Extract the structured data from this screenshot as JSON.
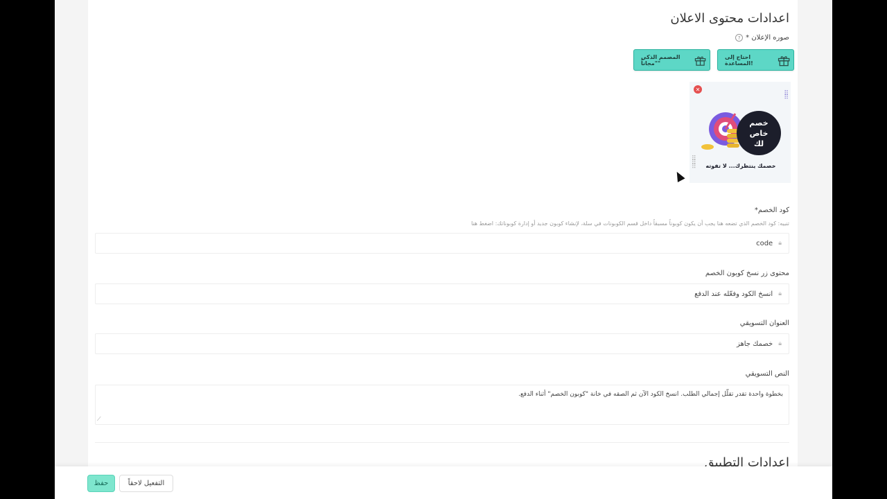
{
  "ad_content": {
    "section_title": "اعدادات محتوى الاعلان",
    "image_label": "صوره الإعلان *",
    "buttons": {
      "need_help": "احتاج إلى المساعدة!",
      "ai_designer": "المصمم الذكي \"مجاناً\""
    },
    "promo_image": {
      "badge_line1": "خصم",
      "badge_line2": "خاص",
      "badge_line3": "لك",
      "subtitle": "خصمك ينتظرك... لا تفوته"
    },
    "coupon_code": {
      "label": "كود الخصم*",
      "hint": "تنبيه: كود الخصم الذي تضعه هنا يجب أن يكون كوبوناً مسبقاً داخل قسم الكوبونات في سلة، لإنشاء كوبون جديد أو إدارة كوبوناتك: اضغط هنا",
      "value": "code"
    },
    "copy_button_text": {
      "label": "محتوى زر نسخ كوبون الخصم",
      "value": "انسخ الكود وفعّله عند الدفع"
    },
    "marketing_title": {
      "label": "العنوان التسويقي",
      "value": "خصمك جاهز"
    },
    "marketing_text": {
      "label": "النص التسويقي",
      "value": "بخطوة واحدة تقدر تقلّل إجمالي الطلب. انسخ الكود الآن ثم الصقه في خانة \"كوبون الخصم\" أثناء الدفع."
    }
  },
  "app_settings": {
    "section_title": "اعدادات التطبيق"
  },
  "footer": {
    "save_label": "حفظ",
    "activate_later_label": "التفعيل لاحقاً"
  },
  "colors": {
    "teal": "#5dd7c6",
    "save_green": "#7ee6ce",
    "close_red": "#e55050"
  }
}
